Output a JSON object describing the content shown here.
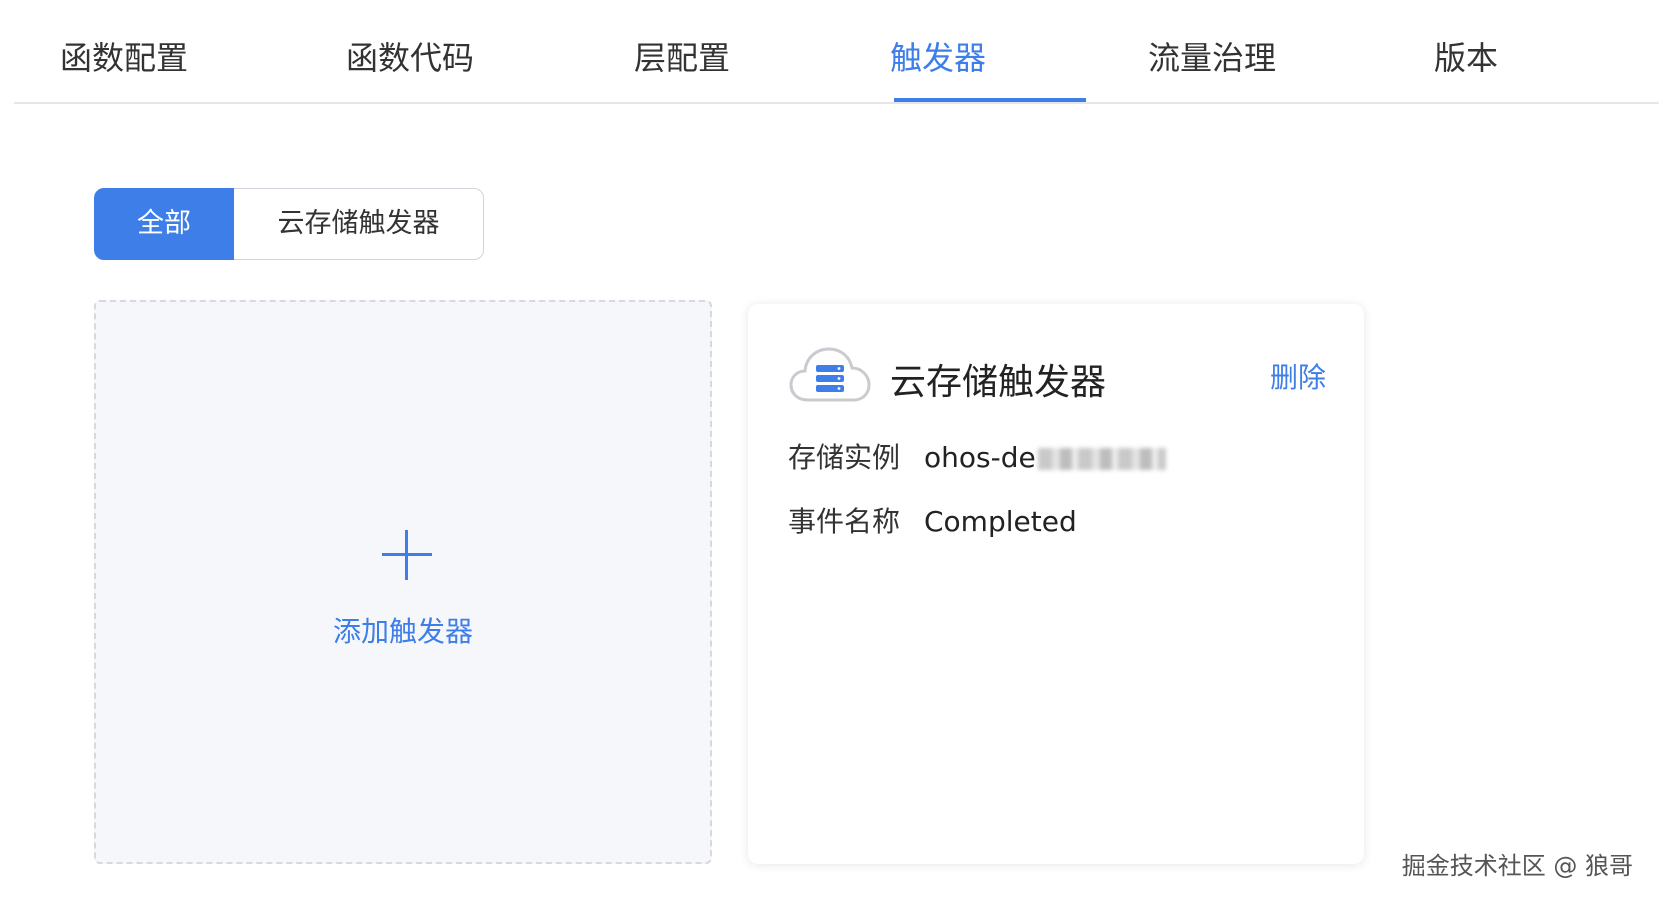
{
  "tabs": [
    {
      "label": "函数配置"
    },
    {
      "label": "函数代码"
    },
    {
      "label": "层配置"
    },
    {
      "label": "触发器"
    },
    {
      "label": "流量治理"
    },
    {
      "label": "版本"
    }
  ],
  "active_tab": "触发器",
  "filter": {
    "all_label": "全部",
    "cloud_storage_label": "云存储触发器",
    "selected": "全部"
  },
  "add_card": {
    "label": "添加触发器",
    "icon": "plus-icon"
  },
  "trigger": {
    "icon": "cloud-storage-icon",
    "title": "云存储触发器",
    "delete_label": "删除",
    "storage_label": "存储实例",
    "storage_value": "ohos-de",
    "event_label": "事件名称",
    "event_value": "Completed"
  },
  "watermark": "掘金技术社区 @ 狼哥",
  "colors": {
    "accent": "#3d7ee8",
    "card_bg": "#f6f7fb",
    "divider": "#e4e6ea"
  }
}
